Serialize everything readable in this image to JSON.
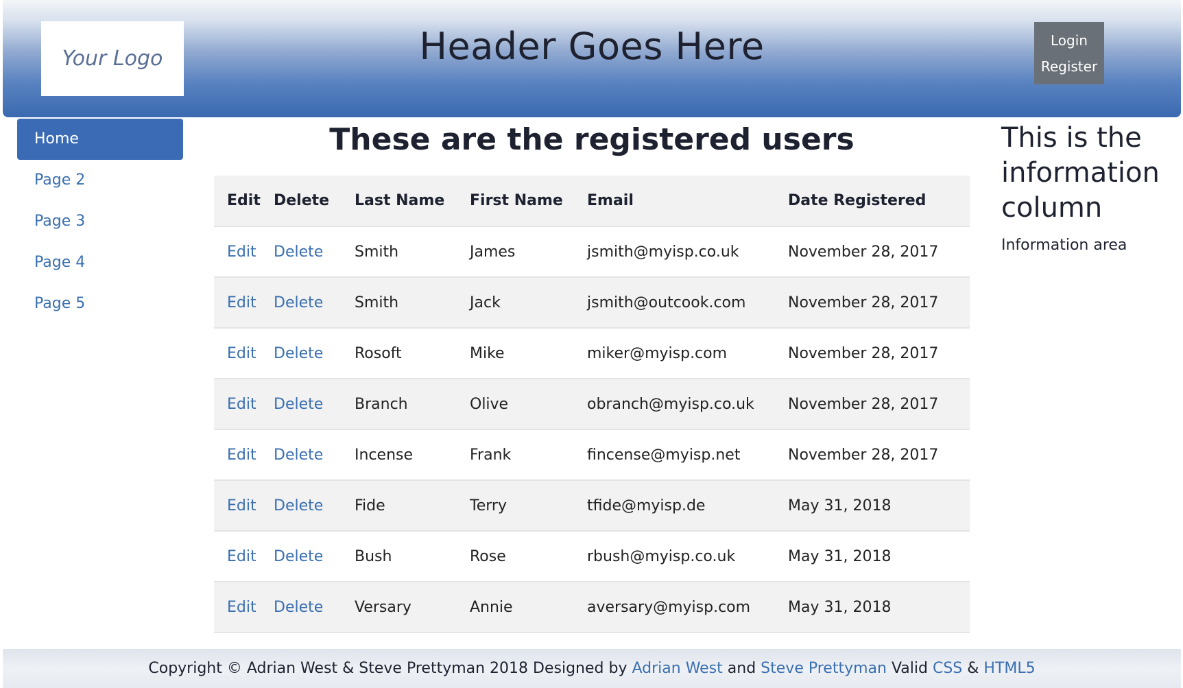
{
  "header": {
    "logo": "Your Logo",
    "title": "Header Goes Here",
    "login": "Login",
    "register": "Register"
  },
  "nav": {
    "items": [
      {
        "label": "Home"
      },
      {
        "label": "Page 2"
      },
      {
        "label": "Page 3"
      },
      {
        "label": "Page 4"
      },
      {
        "label": "Page 5"
      }
    ]
  },
  "main": {
    "title": "These are the registered users",
    "columns": [
      "Edit",
      "Delete",
      "Last Name",
      "First Name",
      "Email",
      "Date Registered"
    ],
    "rows": [
      {
        "edit": "Edit",
        "delete": "Delete",
        "last": "Smith",
        "first": "James",
        "email": "jsmith@myisp.co.uk",
        "date": "November 28, 2017"
      },
      {
        "edit": "Edit",
        "delete": "Delete",
        "last": "Smith",
        "first": "Jack",
        "email": "jsmith@outcook.com",
        "date": "November 28, 2017"
      },
      {
        "edit": "Edit",
        "delete": "Delete",
        "last": "Rosoft",
        "first": "Mike",
        "email": "miker@myisp.com",
        "date": "November 28, 2017"
      },
      {
        "edit": "Edit",
        "delete": "Delete",
        "last": "Branch",
        "first": "Olive",
        "email": "obranch@myisp.co.uk",
        "date": "November 28, 2017"
      },
      {
        "edit": "Edit",
        "delete": "Delete",
        "last": "Incense",
        "first": "Frank",
        "email": "fincense@myisp.net",
        "date": "November 28, 2017"
      },
      {
        "edit": "Edit",
        "delete": "Delete",
        "last": "Fide",
        "first": "Terry",
        "email": "tfide@myisp.de",
        "date": "May 31, 2018"
      },
      {
        "edit": "Edit",
        "delete": "Delete",
        "last": "Bush",
        "first": "Rose",
        "email": "rbush@myisp.co.uk",
        "date": "May 31, 2018"
      },
      {
        "edit": "Edit",
        "delete": "Delete",
        "last": "Versary",
        "first": "Annie",
        "email": "aversary@myisp.com",
        "date": "May 31, 2018"
      }
    ]
  },
  "info": {
    "heading": "This is the information column",
    "text": "Information area"
  },
  "footer": {
    "text1": "Copyright © Adrian West & Steve Prettyman 2018 Designed by ",
    "link1": "Adrian West",
    "text2": " and ",
    "link2": "Steve Prettyman",
    "text3": " Valid ",
    "link3": "CSS",
    "text4": " & ",
    "link4": "HTML5"
  },
  "colors": {
    "link": "#3a6fb0",
    "nav_active": "#3a6bb4",
    "auth_box": "#6a7078",
    "header_bottom": "#3a69b1"
  }
}
